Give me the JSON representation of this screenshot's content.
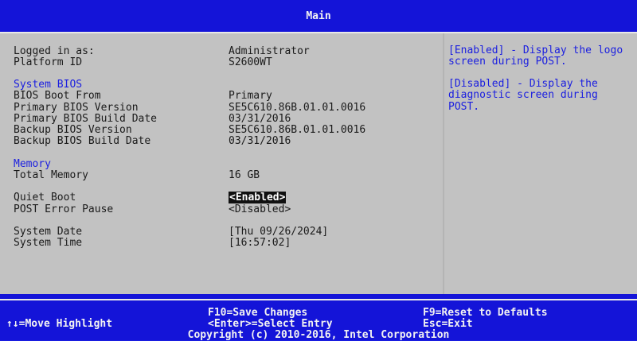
{
  "header": {
    "title": "Main"
  },
  "info": {
    "logged_in_label": "Logged in as:",
    "logged_in_value": "Administrator",
    "platform_id_label": "Platform ID",
    "platform_id_value": "S2600WT"
  },
  "system_bios": {
    "section_title": "System BIOS",
    "boot_from_label": "BIOS Boot From",
    "boot_from_value": "Primary",
    "primary_version_label": "Primary BIOS Version",
    "primary_version_value": "SE5C610.86B.01.01.0016",
    "primary_date_label": "Primary BIOS Build Date",
    "primary_date_value": "03/31/2016",
    "backup_version_label": "Backup BIOS Version",
    "backup_version_value": "SE5C610.86B.01.01.0016",
    "backup_date_label": "Backup BIOS Build Date",
    "backup_date_value": "03/31/2016"
  },
  "memory": {
    "section_title": "Memory",
    "total_label": "Total Memory",
    "total_value": "16 GB"
  },
  "options": {
    "quiet_boot_label": "Quiet Boot",
    "quiet_boot_value": "<Enabled>",
    "post_error_label": "POST Error Pause",
    "post_error_value": "<Disabled>"
  },
  "datetime": {
    "date_label": "System Date",
    "date_value": "[Thu 09/26/2024]",
    "time_label": "System Time",
    "time_value": "[16:57:02]"
  },
  "help": {
    "enabled_text": "[Enabled] - Display the logo screen during POST.",
    "disabled_text": "[Disabled] - Display the diagnostic screen during POST."
  },
  "footer": {
    "move_highlight": "↑↓=Move Highlight",
    "save_changes": "F10=Save Changes",
    "select_entry": "<Enter>=Select Entry",
    "reset_defaults": "F9=Reset to Defaults",
    "exit": "Esc=Exit",
    "copyright": "Copyright (c) 2010-2016, Intel Corporation"
  },
  "colors": {
    "frame_blue": "#1414d8",
    "panel_gray": "#c2c2c2",
    "section_blue": "#1a1ee0",
    "selected_bg": "#101010"
  }
}
